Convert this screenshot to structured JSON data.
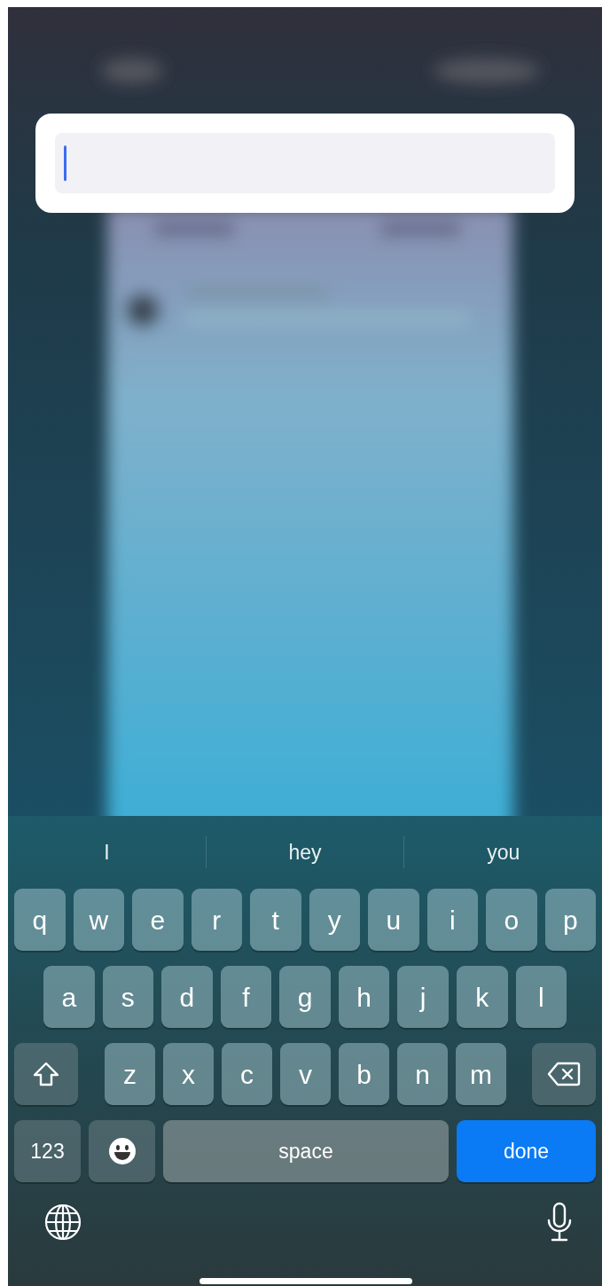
{
  "text_field": {
    "focused": true
  },
  "suggestions": [
    "I",
    "hey",
    "you"
  ],
  "keyboard": {
    "rows": [
      {
        "keys": [
          {
            "kind": "letter",
            "label": "q"
          },
          {
            "kind": "letter",
            "label": "w"
          },
          {
            "kind": "letter",
            "label": "e"
          },
          {
            "kind": "letter",
            "label": "r"
          },
          {
            "kind": "letter",
            "label": "t"
          },
          {
            "kind": "letter",
            "label": "y"
          },
          {
            "kind": "letter",
            "label": "u"
          },
          {
            "kind": "letter",
            "label": "i"
          },
          {
            "kind": "letter",
            "label": "o"
          },
          {
            "kind": "letter",
            "label": "p"
          }
        ]
      },
      {
        "keys": [
          {
            "kind": "letter",
            "label": "a"
          },
          {
            "kind": "letter",
            "label": "s"
          },
          {
            "kind": "letter",
            "label": "d"
          },
          {
            "kind": "letter",
            "label": "f"
          },
          {
            "kind": "letter",
            "label": "g"
          },
          {
            "kind": "letter",
            "label": "h"
          },
          {
            "kind": "letter",
            "label": "j"
          },
          {
            "kind": "letter",
            "label": "k"
          },
          {
            "kind": "letter",
            "label": "l"
          }
        ]
      },
      {
        "keys": [
          {
            "kind": "shift"
          },
          {
            "kind": "letter",
            "label": "z"
          },
          {
            "kind": "letter",
            "label": "x"
          },
          {
            "kind": "letter",
            "label": "c"
          },
          {
            "kind": "letter",
            "label": "v"
          },
          {
            "kind": "letter",
            "label": "b"
          },
          {
            "kind": "letter",
            "label": "n"
          },
          {
            "kind": "letter",
            "label": "m"
          },
          {
            "kind": "backspace"
          }
        ]
      },
      {
        "keys": [
          {
            "kind": "numbers",
            "label": "123"
          },
          {
            "kind": "emoji"
          },
          {
            "kind": "space",
            "label": "space"
          },
          {
            "kind": "return",
            "label": "done"
          }
        ]
      }
    ]
  }
}
